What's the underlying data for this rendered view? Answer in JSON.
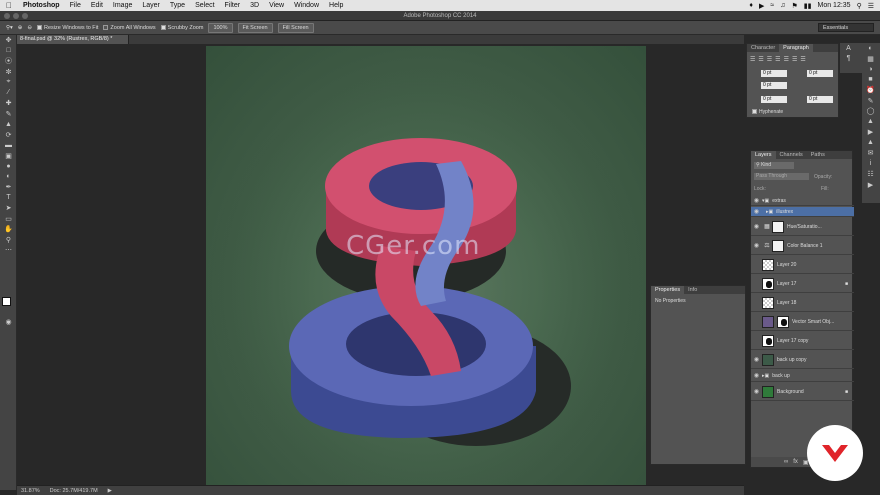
{
  "menubar": {
    "apple": "",
    "items": [
      "Photoshop",
      "File",
      "Edit",
      "Image",
      "Layer",
      "Type",
      "Select",
      "Filter",
      "3D",
      "View",
      "Window",
      "Help"
    ],
    "clock": "Mon 12:35"
  },
  "titlebar": {
    "title": "Adobe Photoshop CC 2014"
  },
  "options": {
    "resize": "Resize Windows to Fit",
    "zoom_all": "Zoom All Windows",
    "scrubby": "Scrubby Zoom",
    "zoom_pct": "100%",
    "fit": "Fit Screen",
    "fill": "Fill Screen"
  },
  "workspace": "Essentials",
  "document": {
    "tab": "8-final.psd @ 32% (Rustrex, RGB/8) *"
  },
  "status": {
    "zoom": "31.87%",
    "doc": "Doc: 25.7M/419.7M"
  },
  "watermark": "CGer.com",
  "charpanel": {
    "tabs": [
      "Character",
      "Paragraph"
    ],
    "fields": [
      "0 pt",
      "0 pt",
      "0 pt",
      "0 pt",
      "0 pt"
    ],
    "hyphenate": "Hyphenate"
  },
  "properties": {
    "tabs": [
      "Properties",
      "Info"
    ],
    "message": "No Properties"
  },
  "layers": {
    "tabs": [
      "Layers",
      "Channels",
      "Paths"
    ],
    "kind": "Kind",
    "blend": "Pass Through",
    "opacity_label": "Opacity:",
    "lock_label": "Lock:",
    "fill_label": "Fill:",
    "items": [
      {
        "name": "extras",
        "kind": "group"
      },
      {
        "name": "illustrex",
        "kind": "group"
      },
      {
        "name": "Hue/Saturatio...",
        "kind": "adj"
      },
      {
        "name": "Color Balance 1",
        "kind": "adj"
      },
      {
        "name": "Layer 20",
        "kind": "checker"
      },
      {
        "name": "Layer 17",
        "kind": "black"
      },
      {
        "name": "Layer 18",
        "kind": "checker"
      },
      {
        "name": "Vector Smart Obj...",
        "kind": "smart"
      },
      {
        "name": "Layer 17 copy",
        "kind": "black"
      },
      {
        "name": "back up copy",
        "kind": "photo"
      },
      {
        "name": "back up",
        "kind": "group"
      },
      {
        "name": "Background",
        "kind": "green"
      }
    ]
  }
}
